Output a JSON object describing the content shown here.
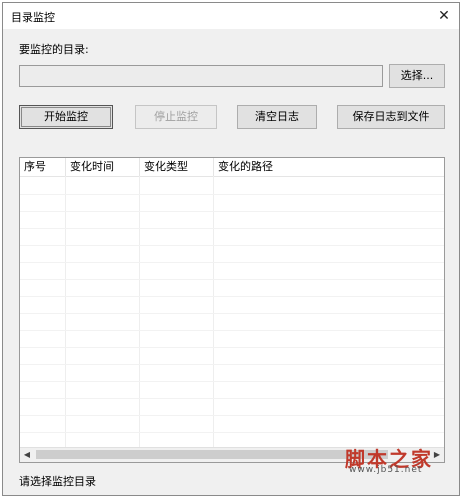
{
  "window": {
    "title": "目录监控",
    "close_glyph": "✕"
  },
  "directory": {
    "label": "要监控的目录:",
    "value": "",
    "browse_label": "选择..."
  },
  "toolbar": {
    "start_label": "开始监控",
    "stop_label": "停止监控",
    "clear_label": "清空日志",
    "save_label": "保存日志到文件"
  },
  "table": {
    "columns": [
      "序号",
      "变化时间",
      "变化类型",
      "变化的路径"
    ],
    "rows": []
  },
  "scrollbar": {
    "left_arrow": "◀",
    "right_arrow": "▶"
  },
  "status": {
    "text": "请选择监控目录"
  },
  "watermark": {
    "text": "脚本之家",
    "url": "www.jb51.net"
  }
}
